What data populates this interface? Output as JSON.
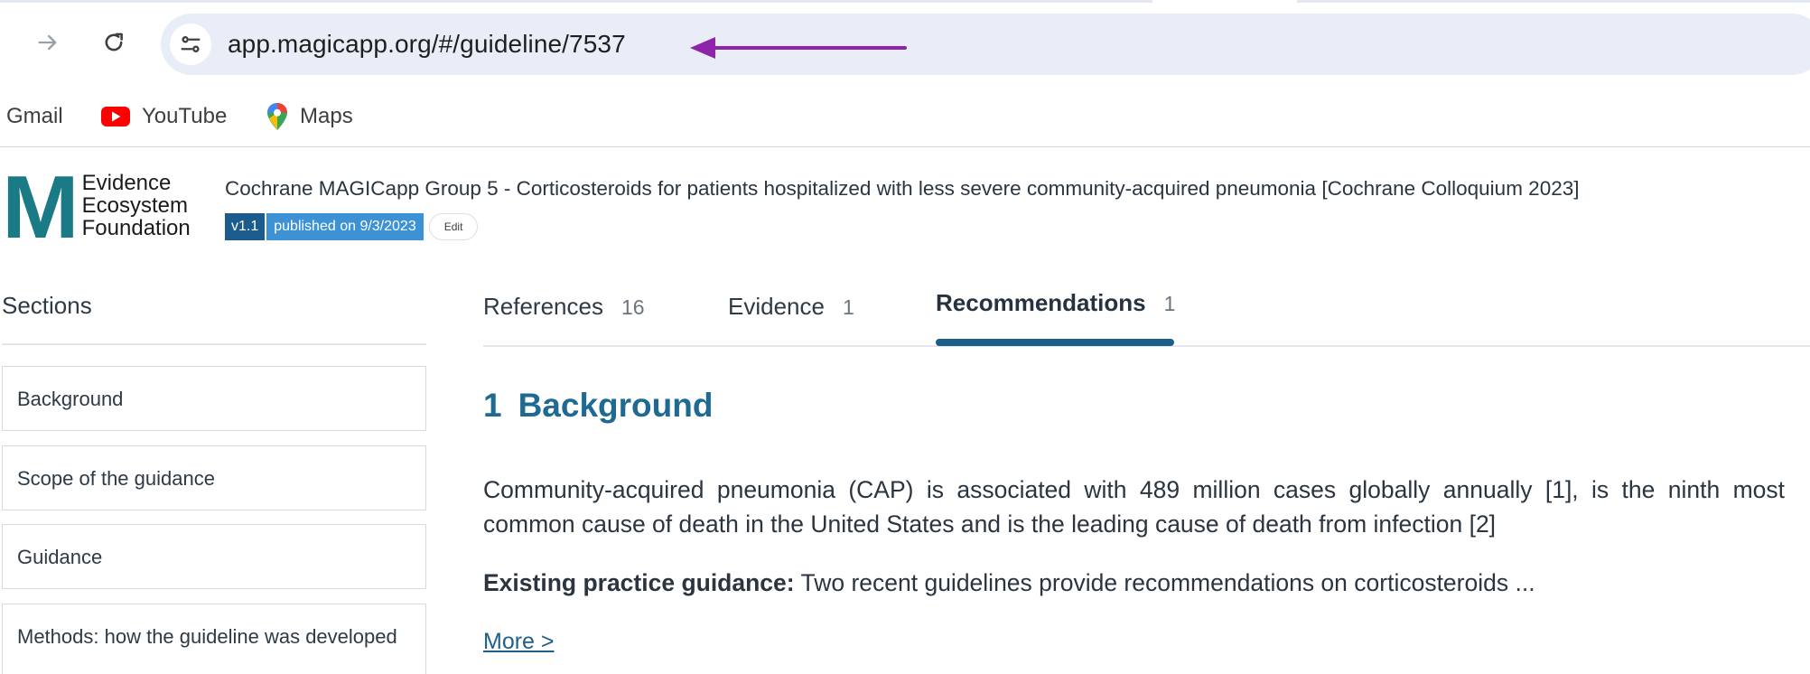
{
  "browser": {
    "url": "app.magicapp.org/#/guideline/7537",
    "bookmarks": [
      {
        "label": "Gmail",
        "icon": "gmail"
      },
      {
        "label": "YouTube",
        "icon": "youtube-icon"
      },
      {
        "label": "Maps",
        "icon": "maps-pin-icon"
      }
    ],
    "annotation_color": "#8e24aa"
  },
  "header": {
    "logo_letter": "M",
    "logo_line1": "Evidence",
    "logo_line2": "Ecosystem",
    "logo_line3": "Foundation",
    "title": "Cochrane MAGICapp Group 5 - Corticosteroids for patients hospitalized with less severe community-acquired pneumonia [Cochrane Colloquium 2023]",
    "version": "v1.1",
    "published": "published on 9/3/2023",
    "edit_label": "Edit"
  },
  "sidebar": {
    "heading": "Sections",
    "items": [
      {
        "label": "Background"
      },
      {
        "label": "Scope of the guidance"
      },
      {
        "label": "Guidance"
      },
      {
        "label": "Methods: how the guideline was developed"
      }
    ]
  },
  "tabs": [
    {
      "label": "References",
      "count": "16"
    },
    {
      "label": "Evidence",
      "count": "1"
    },
    {
      "label": "Recommendations",
      "count": "1",
      "active": true
    }
  ],
  "content": {
    "section_number": "1",
    "section_title": "Background",
    "paragraph1": "Community-acquired pneumonia (CAP) is associated with 489 million cases globally annually [1], is the ninth most common cause of death in the United States and is the leading cause of death from infection [2]",
    "paragraph2_bold": "Existing practice guidance:",
    "paragraph2_text": " Two recent guidelines provide recommendations on corticosteroids ...",
    "more_link": "More >"
  },
  "colors": {
    "brand_teal": "#1a7b87",
    "heading_blue": "#1e6a93",
    "tab_active_underline": "#1d5e8a",
    "badge_version": "#1c5c8c",
    "badge_published": "#3d92d6"
  }
}
